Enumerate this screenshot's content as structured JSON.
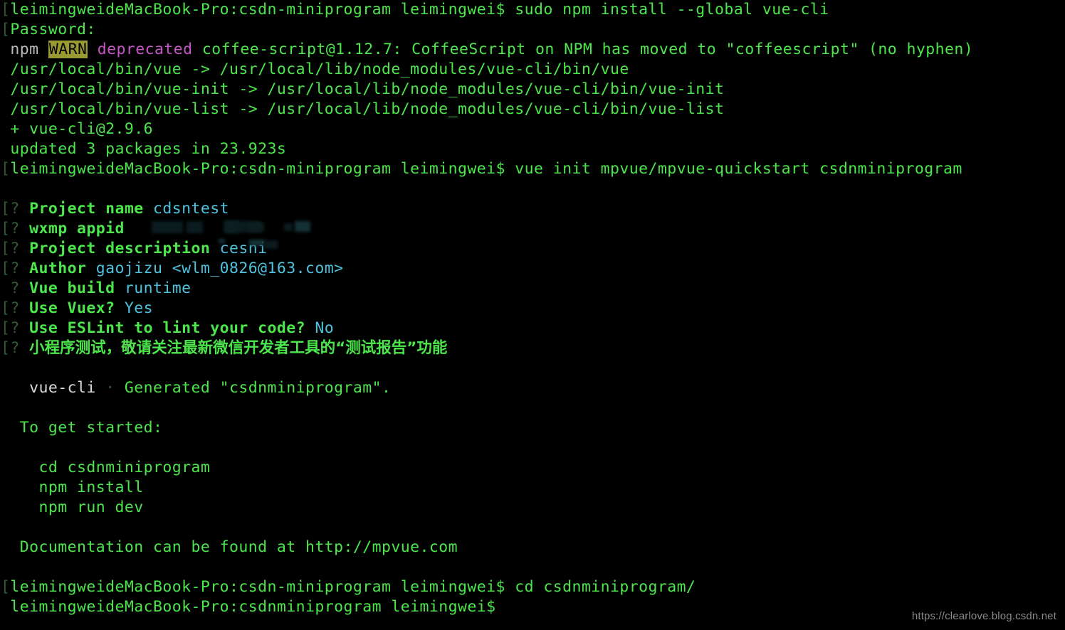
{
  "terminal": {
    "colors": {
      "background": "#000000",
      "green": "#4ce64c",
      "dim_green": "#2f5c36",
      "grey": "#b9b9b9",
      "magenta": "#c755c7",
      "blue": "#4ec2dd",
      "warn_badge_bg": "#9a9a33",
      "warn_badge_fg": "#050505"
    },
    "prompt_host": "leimingweideMacBook-Pro",
    "user": "leimingwei$"
  },
  "lines": {
    "l1_prompt": "[leimingweideMacBook-Pro:csdn-miniprogram leimingwei$",
    "l1_command": "sudo npm install --global vue-cli",
    "l2_password": "[Password:",
    "l3_npm": "npm",
    "l3_warn": "WARN",
    "l3_deprecated": "deprecated",
    "l3_rest": "coffee-script@1.12.7: CoffeeScript on NPM has moved to \"coffeescript\" (no hyphen)",
    "l4": "/usr/local/bin/vue -> /usr/local/lib/node_modules/vue-cli/bin/vue",
    "l5": "/usr/local/bin/vue-init -> /usr/local/lib/node_modules/vue-cli/bin/vue-init",
    "l6": "/usr/local/bin/vue-list -> /usr/local/lib/node_modules/vue-cli/bin/vue-list",
    "l7": "+ vue-cli@2.9.6",
    "l8": "updated 3 packages in 23.923s",
    "l9_prompt": "[leimingweideMacBook-Pro:csdn-miniprogram leimingwei$",
    "l9_command": "vue init mpvue/mpvue-quickstart csdnminiprogram",
    "generated_prefix": "vue-cli",
    "generated_dot": "·",
    "generated_text": "Generated \"csdnminiprogram\".",
    "to_get_started": "To get started:",
    "cmd_cd": "cd csdnminiprogram",
    "cmd_npm_install": "npm install",
    "cmd_npm_run_dev": "npm run dev",
    "documentation": "Documentation can be found at http://mpvue.com",
    "final_prompt_1_host": "[leimingweideMacBook-Pro:csdn-miniprogram leimingwei$",
    "final_prompt_1_command": "cd csdnminiprogram/",
    "final_prompt_2_host": "leimingweideMacBook-Pro:csdnminiprogram leimingwei$"
  },
  "prompts": [
    {
      "marker": "[?",
      "question": "Project name",
      "answer": "cdsntest",
      "redacted": false
    },
    {
      "marker": "[?",
      "question": "wxmp appid",
      "answer": "",
      "redacted": true
    },
    {
      "marker": "[?",
      "question": "Project description",
      "answer": "cesni",
      "redacted": false
    },
    {
      "marker": "[?",
      "question": "Author",
      "answer": "gaojizu <wlm_0826@163.com>",
      "redacted": false
    },
    {
      "marker": " ?",
      "question": "Vue build",
      "answer": "runtime",
      "redacted": false
    },
    {
      "marker": "[?",
      "question": "Use Vuex?",
      "answer": "Yes",
      "redacted": false
    },
    {
      "marker": "[?",
      "question": "Use ESLint to lint your code?",
      "answer": "No",
      "redacted": false
    },
    {
      "marker": "[?",
      "question": "小程序测试，敬请关注最新微信开发者工具的“测试报告”功能",
      "answer": "",
      "redacted": false,
      "cjk": true
    }
  ],
  "watermark": "https://clearlove.blog.csdn.net"
}
